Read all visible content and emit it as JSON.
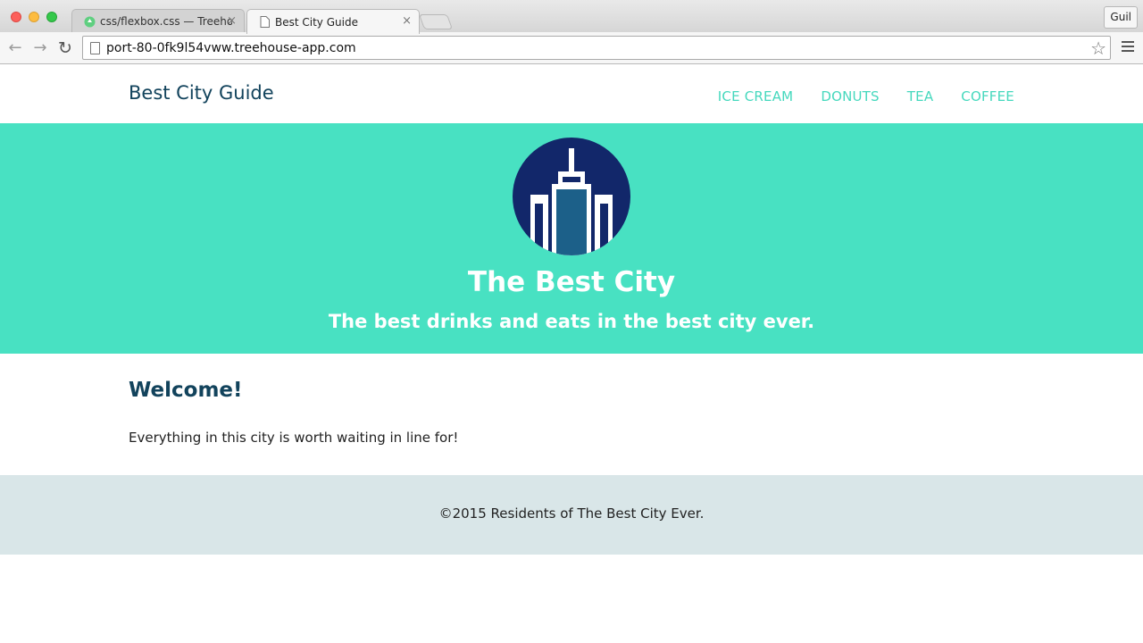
{
  "browser": {
    "tabs": [
      {
        "title": "css/flexbox.css — Treehouse",
        "icon": "treehouse-icon",
        "active": false
      },
      {
        "title": "Best City Guide",
        "icon": "page-icon",
        "active": true
      }
    ],
    "profile": "Guil",
    "url": "port-80-0fk9l54vww.treehouse-app.com",
    "icons": {
      "back": "back-arrow-icon",
      "forward": "forward-arrow-icon",
      "reload": "reload-icon",
      "bookmark": "star-icon",
      "menu": "hamburger-menu-icon"
    }
  },
  "site": {
    "name": "Best City Guide",
    "nav": [
      "ICE CREAM",
      "DONUTS",
      "TEA",
      "COFFEE"
    ],
    "banner": {
      "logo": "city-building-icon",
      "title": "The Best City",
      "tagline": "The best drinks and eats in the best city ever."
    },
    "main": {
      "heading": "Welcome!",
      "text": "Everything in this city is worth waiting in line for!"
    },
    "footer": {
      "copyright": "©2015 Residents of The Best City Ever."
    }
  },
  "colors": {
    "accent": "#48e1c2",
    "nav_link": "#45d8bd",
    "heading": "#12435c",
    "logo_circle": "#12276a",
    "logo_building": "#1c6089",
    "footer_bg": "#d9e6e8"
  }
}
